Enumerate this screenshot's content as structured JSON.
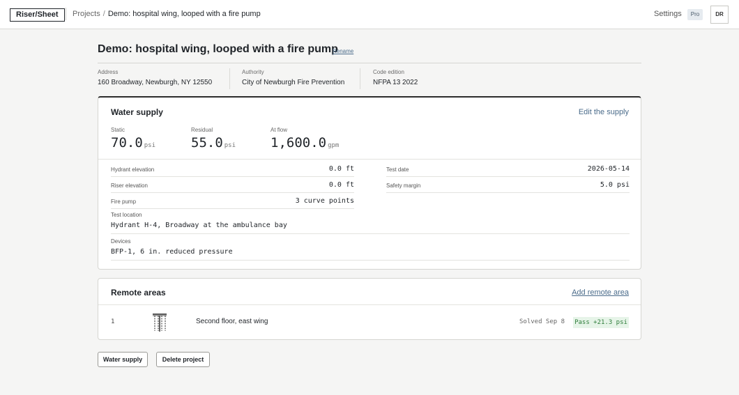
{
  "app": {
    "logo": "Riser/Sheet",
    "breadcrumb": {
      "projects": "Projects",
      "separator": "/",
      "current": "Demo: hospital wing, looped with a fire pump"
    },
    "settings_label": "Settings",
    "plan_badge": "Pro",
    "avatar_initials": "DR"
  },
  "project": {
    "title": "Demo: hospital wing, looped with a fire pump",
    "rename_label": "Rename",
    "address_label": "Address",
    "address": "160 Broadway, Newburgh, NY 12550",
    "authority_label": "Authority",
    "authority": "City of Newburgh Fire Prevention",
    "code_label": "Code edition",
    "code": "NFPA 13 2022"
  },
  "supply": {
    "title": "Water supply",
    "edit_label": "Edit the supply",
    "static_label": "Static",
    "static_value": "70.0",
    "static_unit": "psi",
    "residual_label": "Residual",
    "residual_value": "55.0",
    "residual_unit": "psi",
    "flow_label": "At flow",
    "flow_value": "1,600.0",
    "flow_unit": "gpm",
    "hydrant_elev_label": "Hydrant elevation",
    "hydrant_elev": "0.0 ft",
    "riser_elev_label": "Riser elevation",
    "riser_elev": "0.0 ft",
    "fire_pump_label": "Fire pump",
    "fire_pump": "3 curve points",
    "test_date_label": "Test date",
    "test_date": "2026-05-14",
    "safety_label": "Safety margin",
    "safety": "5.0 psi",
    "test_location_label": "Test location",
    "test_location": "Hydrant H-4, Broadway at the ambulance bay",
    "devices_label": "Devices",
    "devices": "BFP-1, 6 in. reduced pressure"
  },
  "remote_areas": {
    "title": "Remote areas",
    "add_label": "Add remote area",
    "items": [
      {
        "number": "1",
        "name": "Second floor, east wing",
        "solved": "Solved Sep 8",
        "status": "Pass +21.3 psi",
        "status_color": "#2e7d3a"
      }
    ]
  },
  "actions": {
    "water_supply": "Water supply",
    "delete": "Delete project"
  },
  "colors": {
    "accent": "#4a6b8a",
    "pass_bg": "#e6f4e8",
    "pass_fg": "#2e7d3a"
  }
}
